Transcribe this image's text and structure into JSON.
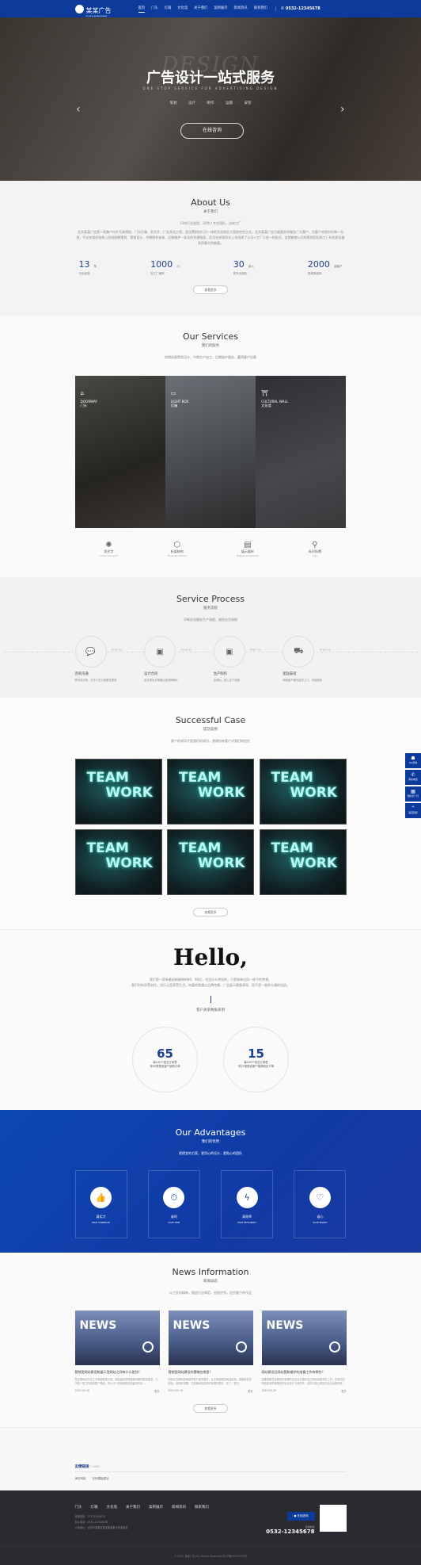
{
  "header": {
    "logo_name": "某某广告",
    "logo_sub": "MOUMOU ADVERTISEMENT",
    "nav": [
      "首页",
      "门头",
      "灯箱",
      "文化墙",
      "关于我们",
      "案例展示",
      "新闻资讯",
      "联系我们"
    ],
    "phone": "0532-12345678"
  },
  "hero": {
    "bg_word": "DESIGN",
    "title": "广告设计一站式服务",
    "subtitle": "ONE STOP SERVICE FOR ADVERTISING DESIGN",
    "steps": [
      "策划",
      "设计",
      "制作",
      "运输",
      "安装"
    ],
    "cta": "在线咨询"
  },
  "about": {
    "title": "About Us",
    "subtitle": "关于我们",
    "tagline": "13年行业经验，30余人专业团队，自有工厂",
    "text": "北京某某广告是一家集户内外写真喷绘、门头灯箱、发光字、广告亮化工程、会议策划执行为一体的华北地区大型综合性企业。北京某某广告为能更好的服务广大客户，为客户合理节约每一分钱，不论在组织结构上形成前期策划、策划设计、中期制作安装、后期维护一条龙的合理链条，而且在经营形式上也选择了公司+工厂二合一的形式，这就能使公司的策划团队和工厂的优质设备发挥最大的能量。",
    "stats": [
      {
        "num": "13",
        "unit": "年",
        "label": "行业经验"
      },
      {
        "num": "1000",
        "unit": "㎡",
        "label": "加工厂面积"
      },
      {
        "num": "30",
        "unit": "余人",
        "label": "的专业团队"
      },
      {
        "num": "2000",
        "unit": "余客户",
        "label": "的诚挚选择"
      }
    ],
    "more": "查看更多"
  },
  "services": {
    "title": "Our Services",
    "subtitle": "我们的服务",
    "desc": "前期创意策划设计，中期生产加工，后期维护服务，赢得客户信赖",
    "panels": [
      {
        "en": "DOORWAY",
        "cn": "门头",
        "icon": "storefront-icon"
      },
      {
        "en": "LIGHT BOX",
        "cn": "灯箱",
        "icon": "lightbox-icon"
      },
      {
        "en": "CULTURAL WALL",
        "cn": "文化墙",
        "icon": "wall-icon"
      }
    ],
    "items": [
      {
        "cn": "发光字",
        "en": "Luminous word",
        "icon": "luminous-icon"
      },
      {
        "cn": "桁架结构",
        "en": "Truss structures",
        "icon": "truss-icon"
      },
      {
        "cn": "展示器材",
        "en": "Display equipment",
        "icon": "display-icon"
      },
      {
        "cn": "标识标牌",
        "en": "sign",
        "icon": "sign-icon"
      }
    ]
  },
  "process": {
    "title": "Service Process",
    "subtitle": "服务流程",
    "desc": "不断优化服务生产流程，缩短交货周期",
    "steps": [
      {
        "no": "STEP 01",
        "name": "咨询沟通",
        "desc": "联系设计师，业务人员为您解答需求",
        "icon": "chat-icon"
      },
      {
        "no": "STEP 02",
        "name": "设计合同",
        "desc": "设计师设计草稿后选样稿确认",
        "icon": "contract-icon"
      },
      {
        "no": "STEP 03",
        "name": "生产制作",
        "desc": "定稿后，进入生产流程",
        "icon": "production-icon"
      },
      {
        "no": "STEP 04",
        "name": "配送安装",
        "desc": "网络客户委托送货上门，安装服务",
        "icon": "truck-icon"
      }
    ]
  },
  "cases": {
    "title": "Successful Case",
    "subtitle": "成功案例",
    "desc": "客户的成功才是我们的成功，感谢所有客户对我们的信任",
    "items": [
      [
        "TEAM",
        "WORK"
      ],
      [
        "TEAM",
        "WORK"
      ],
      [
        "TEAM",
        "WORK"
      ],
      [
        "TEAM",
        "WORK"
      ],
      [
        "TEAM",
        "WORK"
      ],
      [
        "TEAM",
        "WORK"
      ]
    ],
    "more": "查看更多"
  },
  "hello": {
    "title": "Hello,",
    "text1": "我们是一家有着创新精神的80、90后，也没什么特别的，只是和每位同一样子的梦想。",
    "text2": "我们时刻享受创作，也乐让您享受生活。你要的是通过品牌传播，广告展示图像表现，而不是一般的卡通的创造。",
    "caption": "客户关系数据表明",
    "stats": [
      {
        "num": "65",
        "l1": "每100个成交订单里",
        "l2": "有65笔是老客户回购订单"
      },
      {
        "num": "15",
        "l1": "每100个成交订单里",
        "l2": "有15笔是老客户推荐朋友下单"
      }
    ]
  },
  "advantages": {
    "title": "Our Advantages",
    "subtitle": "我们的优势",
    "desc": "更便宜的方案，更用心的设计，更贴心的团队",
    "items": [
      {
        "cn": "真实力",
        "en": "TRUE STRENGTH",
        "icon": "thumbs-up-icon"
      },
      {
        "cn": "省时",
        "en": "SAVE TIME",
        "icon": "stopwatch-icon"
      },
      {
        "cn": "高效率",
        "en": "HIGH EFFICIENCY",
        "icon": "lightning-icon"
      },
      {
        "cn": "省心",
        "en": "SAVE WORRY",
        "icon": "heart-icon"
      }
    ]
  },
  "news": {
    "title": "News Information",
    "subtitle": "新闻动态",
    "desc": "以工匠的精神，锻造行业典范，创造优秀，适合客户的作品",
    "items": [
      {
        "img": "NEWS",
        "title": "营销型网站建设和展示型网站之间有什么差别？",
        "text": "在互联网站开发之中营销型的分类，网站建设获得营销效果的想法更多，几乎整一类之所建的整个等级，所以什么是营销型网站建设的区...",
        "date": "2020-04-16",
        "more": "更多"
      },
      {
        "img": "NEWS",
        "title": "营销型网站建设的策略在哪里？",
        "text": "网站在互联网营销型的有方面的制作，企业营销型的网站建设、选题和营型网站。选择好需要，才能使网站建设时效果好更好，这个，很行...",
        "date": "2020-04-16",
        "more": "更多"
      },
      {
        "img": "NEWS",
        "title": "网站建设后网站营和维护的准备工作有哪些？",
        "text": "如果想要在互联网在营销的企业站点做好自己的网站相关的工作，在网站的网站建设的管理维护后在设计下面的开，这样才能让网站在日后运营所用...",
        "date": "2020-04-16",
        "more": "更多"
      }
    ],
    "more": "查看更多"
  },
  "links": {
    "title": "友情链接",
    "title_en": "/ LINKS",
    "items": [
      "海右网络",
      "无忧模板建站"
    ]
  },
  "footer": {
    "nav": [
      "门头",
      "灯箱",
      "文化墙",
      "关于我们",
      "案例展示",
      "新闻资讯",
      "联系我们"
    ],
    "info": [
      "咨询热线：13712345678",
      "办公电话：0532-12345678",
      "公司地址：北京市某某区某某路某某大厦某某室"
    ],
    "online": "在线咨询",
    "hotline_label": "咨询热线",
    "hotline": "0532-12345678",
    "copyright": "© 2021 某某广告 ALL Rights Reserved 京ICP备00000000号"
  },
  "float": [
    {
      "label": "QQ咨询",
      "icon": "qq-icon"
    },
    {
      "label": "联系电话",
      "icon": "phone-icon"
    },
    {
      "label": "微信扫一扫",
      "icon": "qrcode-icon"
    },
    {
      "label": "返回顶部",
      "icon": "top-icon"
    }
  ]
}
